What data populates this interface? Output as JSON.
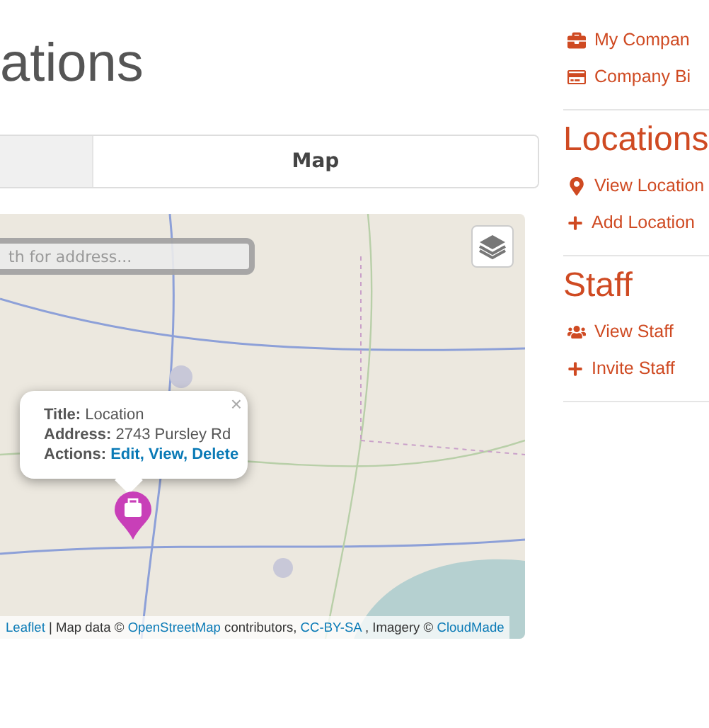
{
  "page_title": "ations",
  "tabs": [
    {
      "selected": false
    },
    {
      "label": "Map",
      "selected": true
    }
  ],
  "map": {
    "search": {
      "placeholder": "th for address..."
    },
    "popup": {
      "close": "×",
      "title": "**Title:** Location",
      "address": "**Address:** 2743 Pursley Rd",
      "actions_label": "Actions:",
      "separator": ",",
      "actions": [
        "Edit",
        "View",
        "Delete"
      ]
    },
    "attribution": [
      {
        "kind": "link",
        "text": "Leaflet"
      },
      {
        "kind": "text",
        "text": "| Map data ©"
      },
      {
        "kind": "link",
        "text": "OpenStreetMap"
      },
      {
        "kind": "text",
        "text": "contributors,"
      },
      {
        "kind": "link",
        "text": "CC-BY-SA"
      },
      {
        "kind": "text",
        "text": ", Imagery ©"
      },
      {
        "kind": "link",
        "text": "CloudMade"
      }
    ]
  },
  "sidebar": {
    "sections": [
      {
        "items": [
          "My Compan",
          "Company Bi"
        ]
      },
      {
        "heading": "Locations",
        "items": [
          "View Location",
          "Add Location"
        ]
      },
      {
        "heading": "Staff",
        "items": [
          "View Staff",
          "Invite Staff"
        ]
      }
    ]
  }
}
